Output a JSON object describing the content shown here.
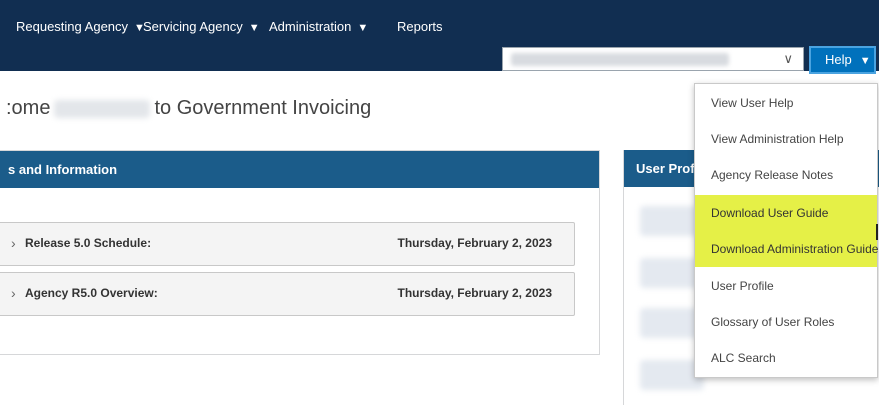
{
  "nav": {
    "items": [
      {
        "label": "Requesting Agency",
        "caret": "▼"
      },
      {
        "label": "Servicing Agency",
        "caret": "▼"
      },
      {
        "label": "Administration",
        "caret": "▼"
      },
      {
        "label": "Reports",
        "caret": ""
      }
    ]
  },
  "agency_select": {
    "chevron": "∨"
  },
  "help_button": {
    "label": "Help",
    "caret": "▼"
  },
  "welcome": {
    "prefix": ":ome",
    "suffix": "to Government Invoicing"
  },
  "news": {
    "header": "s and Information",
    "rows": [
      {
        "title": "Release 5.0 Schedule:",
        "date": "Thursday, February 2, 2023"
      },
      {
        "title": "Agency R5.0 Overview:",
        "date": "Thursday, February 2, 2023"
      }
    ]
  },
  "profile": {
    "header": "User Profile"
  },
  "help_menu": {
    "items": [
      {
        "label": "View User Help",
        "highlighted": false
      },
      {
        "label": "View Administration Help",
        "highlighted": false
      },
      {
        "label": "Agency Release Notes",
        "highlighted": false
      },
      {
        "label": "Download User Guide",
        "highlighted": true
      },
      {
        "label": "Download Administration Guide",
        "highlighted": true
      },
      {
        "label": "User Profile",
        "highlighted": false
      },
      {
        "label": "Glossary of User Roles",
        "highlighted": false
      },
      {
        "label": "ALC Search",
        "highlighted": false
      }
    ]
  },
  "colors": {
    "nav_bg": "#112e51",
    "panel_header": "#1b5c8a",
    "help_button": "#0071bc",
    "highlight": "#e5f047"
  }
}
